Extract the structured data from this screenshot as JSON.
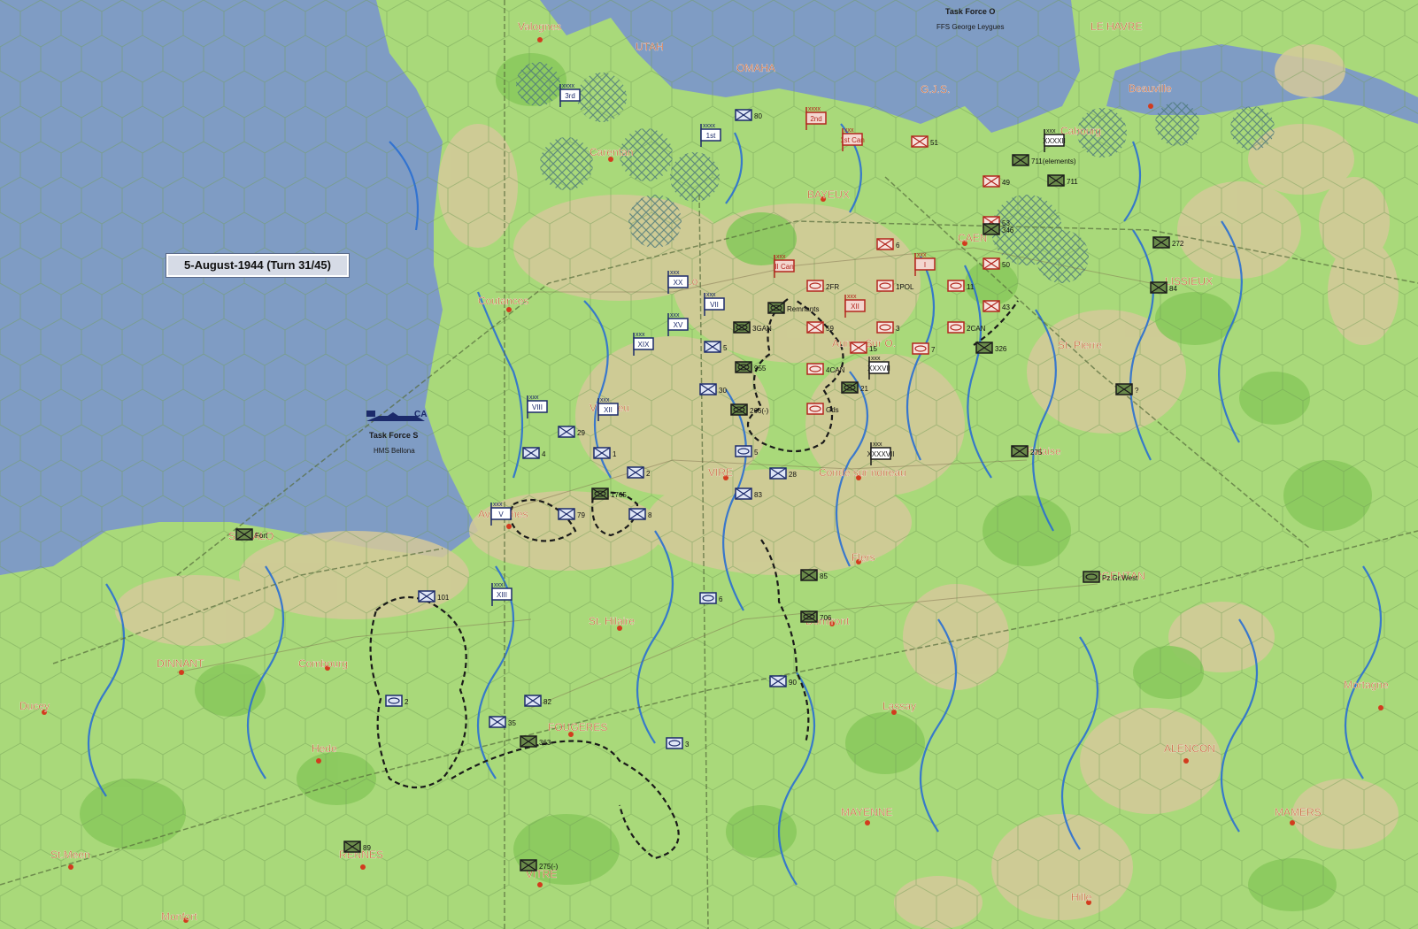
{
  "turn_label": "5-August-1944 (Turn 31/45)",
  "colors": {
    "sea": "#7f9cc4",
    "land": "#a9d97a",
    "land_dark": "#89c95d",
    "rough": "#d5c99a",
    "river": "#2a6fd1",
    "town_label": "#c0521f",
    "allied_unit": "#1c2a6b",
    "axis_unit": "#1a1a1a",
    "british_unit": "#b3261e",
    "front_line": "#1a1a1a"
  },
  "towns": [
    {
      "name": "Valognes"
    },
    {
      "name": "UTAH"
    },
    {
      "name": "OMAHA"
    },
    {
      "name": "G.J.S."
    },
    {
      "name": "LE HAVRE"
    },
    {
      "name": "Beauville"
    },
    {
      "name": "Cabourg"
    },
    {
      "name": "Carentan"
    },
    {
      "name": "BAYEUX"
    },
    {
      "name": "CAEN"
    },
    {
      "name": "LISSIEUX"
    },
    {
      "name": "St. Lo"
    },
    {
      "name": "Coutances"
    },
    {
      "name": "Aunay Sur O."
    },
    {
      "name": "St. Pierre"
    },
    {
      "name": "Villedieu"
    },
    {
      "name": "Falaise"
    },
    {
      "name": "VIRE"
    },
    {
      "name": "Conde sur noireau"
    },
    {
      "name": "Avranches"
    },
    {
      "name": "ST.MALO"
    },
    {
      "name": "Flers"
    },
    {
      "name": "ARGENTAN"
    },
    {
      "name": "St. Hilaire"
    },
    {
      "name": "Domfront"
    },
    {
      "name": "DINNANT"
    },
    {
      "name": "Combourg"
    },
    {
      "name": "Ducey"
    },
    {
      "name": "Lassay"
    },
    {
      "name": "Mortagne"
    },
    {
      "name": "FOUGERES"
    },
    {
      "name": "Hede"
    },
    {
      "name": "ALENCON"
    },
    {
      "name": "MAYENNE"
    },
    {
      "name": "MAMERS"
    },
    {
      "name": "St.Meen"
    },
    {
      "name": "RENNES"
    },
    {
      "name": "VITRE"
    },
    {
      "name": "Hille"
    },
    {
      "name": "Monfort"
    }
  ],
  "naval": [
    {
      "title": "Task Force O",
      "ship": "FFS George Leygues"
    },
    {
      "title": "Task Force S",
      "ship": "HMS Bellona",
      "type": "CA"
    }
  ],
  "units": {
    "allied": [
      {
        "type": "army",
        "label": "3rd"
      },
      {
        "type": "army",
        "label": "1st"
      },
      {
        "type": "corps",
        "label": "XX"
      },
      {
        "type": "corps",
        "label": "VII"
      },
      {
        "type": "corps",
        "label": "XV"
      },
      {
        "type": "corps",
        "label": "XIX"
      },
      {
        "type": "corps",
        "label": "VIII"
      },
      {
        "type": "corps",
        "label": "XIII"
      },
      {
        "type": "corps",
        "label": "V"
      },
      {
        "type": "corps",
        "label": "XII"
      },
      {
        "type": "inf",
        "label": "80"
      },
      {
        "type": "inf",
        "label": "5"
      },
      {
        "type": "inf",
        "label": "30"
      },
      {
        "type": "inf",
        "label": "29"
      },
      {
        "type": "inf",
        "label": "4"
      },
      {
        "type": "inf",
        "label": "1"
      },
      {
        "type": "inf",
        "label": "2"
      },
      {
        "type": "inf",
        "label": "28"
      },
      {
        "type": "inf",
        "label": "83"
      },
      {
        "type": "inf",
        "label": "79"
      },
      {
        "type": "inf",
        "label": "8"
      },
      {
        "type": "inf",
        "label": "90"
      },
      {
        "type": "inf",
        "label": "35"
      },
      {
        "type": "armor",
        "label": "6"
      },
      {
        "type": "armor",
        "label": "3"
      },
      {
        "type": "armor",
        "label": "2"
      },
      {
        "type": "armor",
        "label": "5"
      },
      {
        "type": "ab",
        "label": "101"
      },
      {
        "type": "ab",
        "label": "82"
      }
    ],
    "british": [
      {
        "type": "army",
        "label": "2nd"
      },
      {
        "type": "corps",
        "label": "1st Can"
      },
      {
        "type": "corps",
        "label": "II Can"
      },
      {
        "type": "corps",
        "label": "XII"
      },
      {
        "type": "corps",
        "label": "I"
      },
      {
        "type": "inf",
        "label": "51"
      },
      {
        "type": "inf",
        "label": "6"
      },
      {
        "type": "inf",
        "label": "50"
      },
      {
        "type": "inf",
        "label": "49"
      },
      {
        "type": "inf",
        "label": "43"
      },
      {
        "type": "inf",
        "label": "15"
      },
      {
        "type": "inf",
        "label": "59"
      },
      {
        "type": "inf",
        "label": "53"
      },
      {
        "type": "armor",
        "label": "2FR"
      },
      {
        "type": "armor",
        "label": "1POL"
      },
      {
        "type": "armor",
        "label": "11"
      },
      {
        "type": "armor",
        "label": "3"
      },
      {
        "type": "armor",
        "label": "2CAN"
      },
      {
        "type": "armor",
        "label": "7"
      },
      {
        "type": "armor",
        "label": "4CAN"
      },
      {
        "type": "armor",
        "label": "Gds"
      }
    ],
    "axis": [
      {
        "type": "corps",
        "label": "XXXXII"
      },
      {
        "type": "inf",
        "label": "711(elements)"
      },
      {
        "type": "inf",
        "label": "711"
      },
      {
        "type": "inf",
        "label": "346"
      },
      {
        "type": "inf",
        "label": "326"
      },
      {
        "type": "inf",
        "label": "272"
      },
      {
        "type": "inf",
        "label": "?"
      },
      {
        "type": "inf",
        "label": "363"
      },
      {
        "type": "inf",
        "label": "85"
      },
      {
        "type": "inf",
        "label": "275"
      },
      {
        "type": "inf",
        "label": "275(-)"
      },
      {
        "type": "inf",
        "label": "89"
      },
      {
        "type": "inf",
        "label": "84"
      },
      {
        "type": "mech",
        "label": "955"
      },
      {
        "type": "mech",
        "label": "266(-)"
      },
      {
        "type": "mech",
        "label": "21"
      },
      {
        "type": "mech",
        "label": "706"
      },
      {
        "type": "mech",
        "label": "Remnants"
      },
      {
        "type": "mech",
        "label": "1765"
      },
      {
        "type": "mech",
        "label": "3GAN"
      },
      {
        "type": "fort",
        "label": "Fort"
      },
      {
        "type": "corps",
        "label": "XXXVII"
      },
      {
        "type": "corps",
        "label": "XXXXVII"
      },
      {
        "type": "armor",
        "label": "Pz.Gr.West"
      }
    ]
  }
}
